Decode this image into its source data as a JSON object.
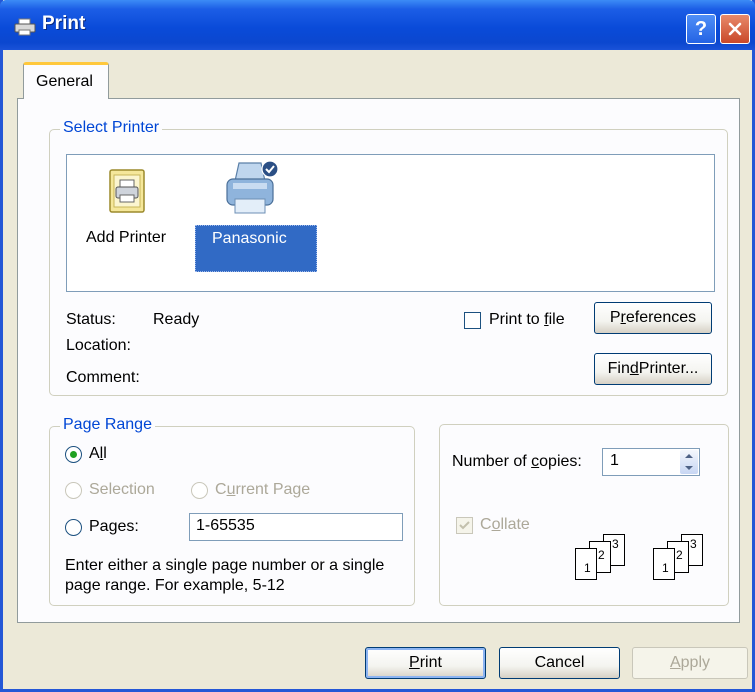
{
  "window": {
    "title": "Print"
  },
  "tabs": [
    {
      "label": "General"
    }
  ],
  "select_printer": {
    "group_title": "Select Printer",
    "printers": [
      {
        "label": "Add Printer",
        "icon": "add-printer-icon"
      },
      {
        "label": "Panasonic",
        "icon": "printer-icon",
        "selected": true
      }
    ],
    "status_label": "Status:",
    "status_value": "Ready",
    "location_label": "Location:",
    "comment_label": "Comment:",
    "print_to_file": {
      "label_pre": "Print to ",
      "label_u": "f",
      "label_post": "ile",
      "checked": false
    },
    "preferences": {
      "label_pre": "P",
      "label_u": "r",
      "label_post": "eferences"
    },
    "find_printer": {
      "label_pre": "Fin",
      "label_u": "d",
      "label_post": " Printer..."
    }
  },
  "page_range": {
    "group_title": "Page Range",
    "all": {
      "label_pre": "A",
      "label_u": "l",
      "label_post": "l",
      "selected": true
    },
    "selection": {
      "label": "Selection",
      "enabled": false
    },
    "current_page": {
      "label_pre": "C",
      "label_u": "u",
      "label_post": "rrent Page",
      "enabled": false
    },
    "pages": {
      "label_pre": "Pa",
      "label_u": "g",
      "label_post": "es:",
      "value": "1-65535"
    },
    "hint_line1": "Enter either a single page number or a single",
    "hint_line2": "page range.  For example, 5-12"
  },
  "copies": {
    "label_pre": "Number of ",
    "label_u": "c",
    "label_post": "opies:",
    "value": "1",
    "collate": {
      "label_pre": "C",
      "label_u": "o",
      "label_post": "llate",
      "checked": true,
      "enabled": false
    },
    "collate_icon_pages": [
      "1",
      "2",
      "3"
    ]
  },
  "buttons": {
    "print": {
      "label_u": "P",
      "label_post": "rint"
    },
    "cancel": "Cancel",
    "apply": {
      "label_u": "A",
      "label_post": "pply"
    }
  },
  "colors": {
    "title_bar": "#0a4bd9",
    "group_title": "#0046d5",
    "selection": "#316ac5",
    "radio_dot": "#21a121"
  }
}
